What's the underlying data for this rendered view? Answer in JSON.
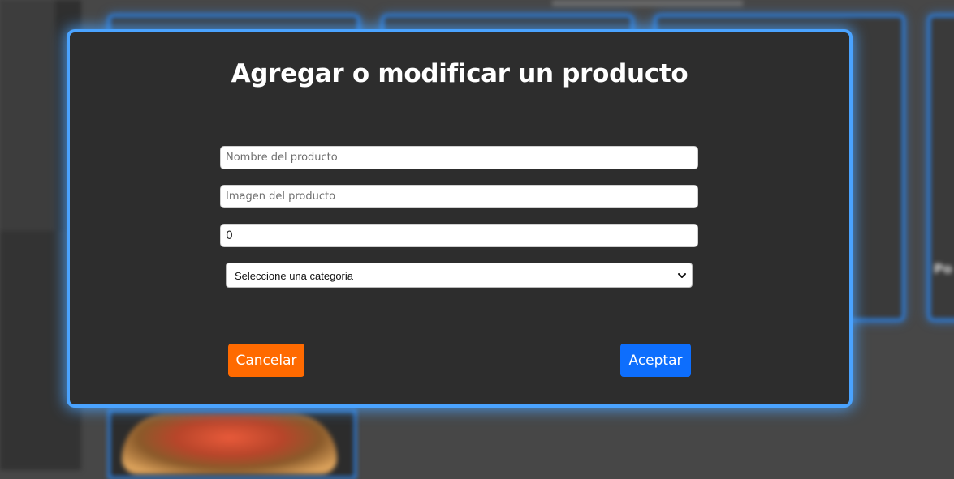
{
  "modal": {
    "title": "Agregar o modificar un producto",
    "fields": {
      "name_placeholder": "Nombre del producto",
      "image_placeholder": "Imagen del producto",
      "price_value": "0"
    },
    "category_select": {
      "selected": "Seleccione una categoria"
    },
    "buttons": {
      "cancel_label": "Cancelar",
      "accept_label": "Aceptar"
    }
  },
  "background": {
    "partial_label": "Po"
  },
  "colors": {
    "modal_bg": "#2d2d2d",
    "modal_glow": "#4aa3ff",
    "cancel_button": "#ff6a00",
    "accept_button": "#0d6efd",
    "card_border": "#2a8cff"
  },
  "icons": {
    "select_arrow": "chevron-down-icon"
  }
}
